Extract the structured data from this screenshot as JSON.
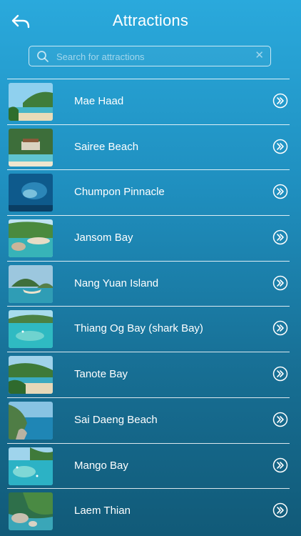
{
  "header": {
    "title": "Attractions",
    "back_icon": "back-arrow-icon"
  },
  "search": {
    "placeholder": "Search for attractions",
    "value": ""
  },
  "attractions": [
    {
      "name": "Mae Haad"
    },
    {
      "name": "Sairee Beach"
    },
    {
      "name": "Chumpon Pinnacle"
    },
    {
      "name": "Jansom Bay"
    },
    {
      "name": "Nang Yuan Island"
    },
    {
      "name": "Thiang Og Bay (shark Bay)"
    },
    {
      "name": "Tanote Bay"
    },
    {
      "name": "Sai Daeng Beach"
    },
    {
      "name": "Mango Bay"
    },
    {
      "name": "Laem Thian"
    }
  ],
  "colors": {
    "bg_top": "#2aa9dc",
    "bg_bottom": "#115a78",
    "text": "#ffffff"
  }
}
